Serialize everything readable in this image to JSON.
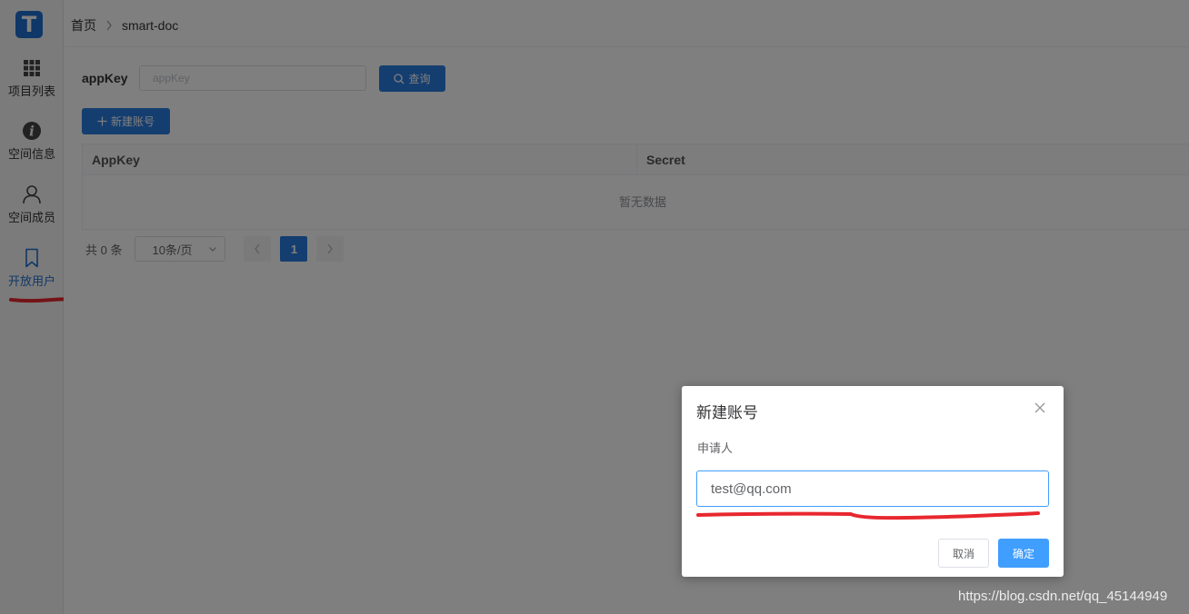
{
  "sidebar": {
    "logo": "T",
    "items": [
      {
        "label": "项目列表",
        "icon": "grid-icon"
      },
      {
        "label": "空间信息",
        "icon": "info-icon"
      },
      {
        "label": "空间成员",
        "icon": "user-icon"
      },
      {
        "label": "开放用户",
        "icon": "bookmark-icon"
      }
    ]
  },
  "header": {
    "breadcrumb": [
      "首页",
      "smart-doc"
    ]
  },
  "search": {
    "label": "appKey",
    "placeholder": "appKey",
    "query_label": "查询"
  },
  "toolbar": {
    "new_label": "新建账号"
  },
  "table": {
    "columns": [
      "AppKey",
      "Secret"
    ],
    "empty_text": "暂无数据"
  },
  "pagination": {
    "total": "共 0 条",
    "page_size": "10条/页",
    "current_page": "1"
  },
  "dialog": {
    "title": "新建账号",
    "field_label": "申请人",
    "field_value": "test@qq.com",
    "cancel_label": "取消",
    "ok_label": "确定"
  },
  "watermark": "https://blog.csdn.net/qq_45144949",
  "colors": {
    "primary": "#2a7de1",
    "dialog_primary": "#409eff",
    "annotation_red": "#e8272f"
  }
}
